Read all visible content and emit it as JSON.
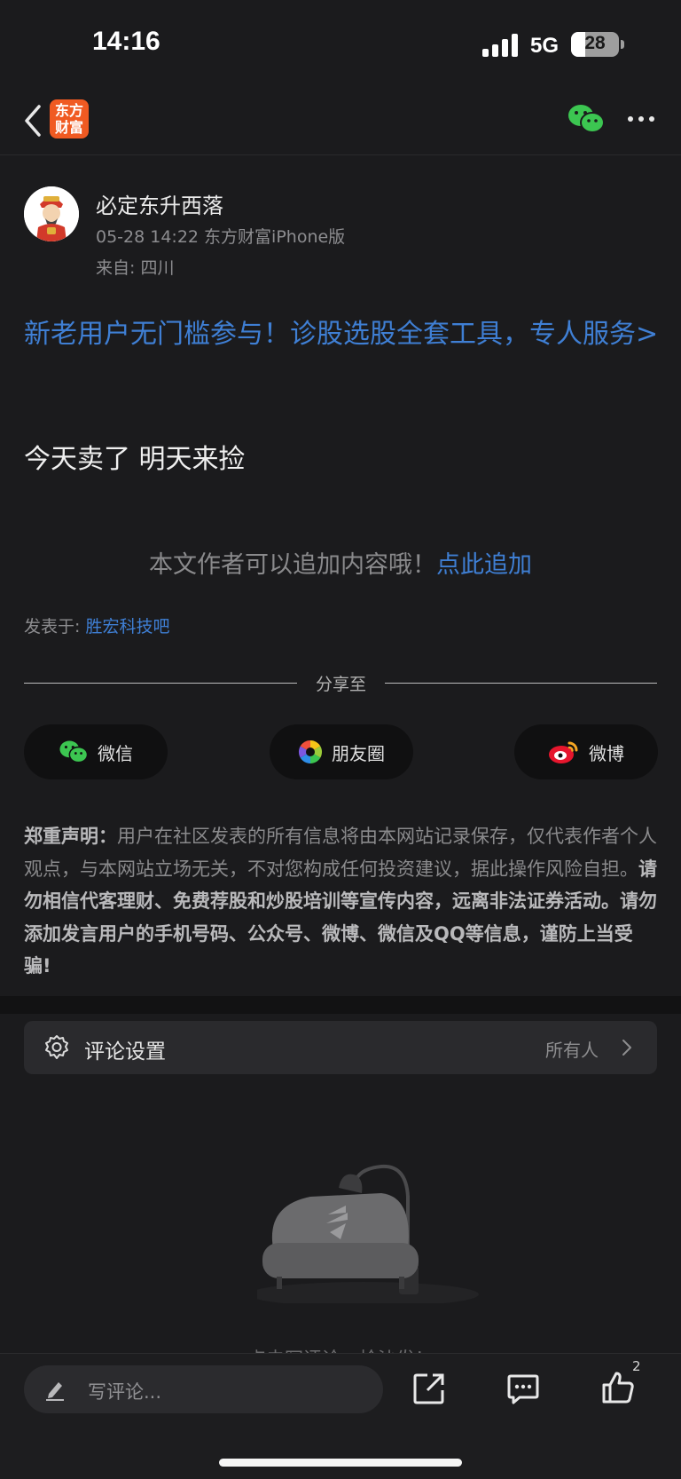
{
  "status_bar": {
    "time": "14:16",
    "network": "5G",
    "battery": "28"
  },
  "nav": {
    "logo_line1": "东方",
    "logo_line2": "财富"
  },
  "author": {
    "name": "必定东升西落",
    "meta": "05-28 14:22 东方财富iPhone版",
    "location": "来自: 四川"
  },
  "post": {
    "promo": "新老用户无门槛参与！诊股选股全套工具，专人服务>",
    "body": "今天卖了 明天来捡"
  },
  "append": {
    "text": "本文作者可以追加内容哦！",
    "link": "点此追加"
  },
  "posted_in": {
    "label": "发表于: ",
    "bar": "胜宏科技吧"
  },
  "share": {
    "label": "分享至",
    "buttons": [
      {
        "label": "微信",
        "icon": "wechat-icon"
      },
      {
        "label": "朋友圈",
        "icon": "moments-icon"
      },
      {
        "label": "微博",
        "icon": "weibo-icon"
      }
    ]
  },
  "disclaimer": {
    "title": "郑重声明：",
    "normal": "用户在社区发表的所有信息将由本网站记录保存，仅代表作者个人观点，与本网站立场无关，不对您构成任何投资建议，据此操作风险自担。",
    "bold": "请勿相信代客理财、免费荐股和炒股培训等宣传内容，远离非法证券活动。请勿添加发言用户的手机号码、公众号、微博、微信及QQ等信息，谨防上当受骗!"
  },
  "comment_settings": {
    "label": "评论设置",
    "value": "所有人"
  },
  "empty_state": {
    "text": "点击写评论，抢沙发！"
  },
  "bottom_bar": {
    "placeholder": "写评论...",
    "like_count": "2"
  },
  "colors": {
    "link": "#3f7fd4",
    "background": "#1b1b1d",
    "brand": "#f05a22",
    "wechat": "#3cc651"
  }
}
